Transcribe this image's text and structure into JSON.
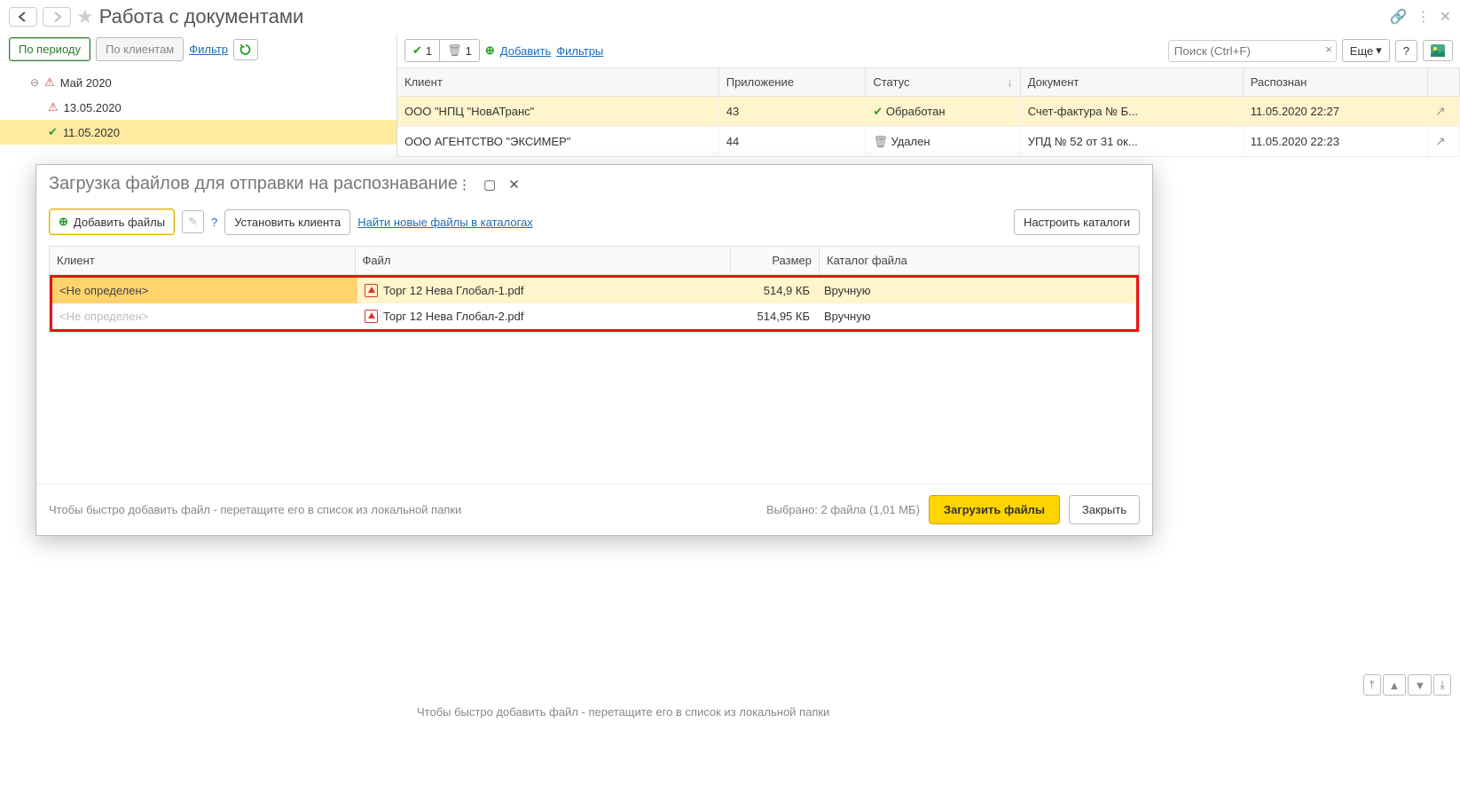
{
  "header": {
    "title": "Работа с документами"
  },
  "tabs": {
    "period": "По периоду",
    "clients": "По клиентам",
    "filter": "Фильтр"
  },
  "tree": {
    "month": "Май 2020",
    "date1": "13.05.2020",
    "date2": "11.05.2020"
  },
  "rtoolbar": {
    "ok_count": "1",
    "del_count": "1",
    "add": "Добавить",
    "filters": "Фильтры",
    "search_placeholder": "Поиск (Ctrl+F)",
    "more": "Еще",
    "help": "?"
  },
  "main_cols": {
    "client": "Клиент",
    "attach": "Приложение",
    "status": "Статус",
    "doc": "Документ",
    "recognized": "Распознан"
  },
  "main_rows": [
    {
      "client": "ООО \"НПЦ \"НовАТранс\"",
      "attach": "43",
      "status": "Обработан",
      "status_icon": "ok",
      "doc": "Счет-фактура № Б...",
      "rec": "11.05.2020 22:27"
    },
    {
      "client": "ООО АГЕНТСТВО \"ЭКСИМЕР\"",
      "attach": "44",
      "status": "Удален",
      "status_icon": "trash",
      "doc": "УПД № 52 от 31 ок...",
      "rec": "11.05.2020 22:23"
    }
  ],
  "modal": {
    "title": "Загрузка файлов для отправки на распознавание",
    "add_files": "Добавить файлы",
    "help": "?",
    "set_client": "Установить клиента",
    "find_new": "Найти новые файлы в каталогах",
    "setup_cat": "Настроить каталоги",
    "cols": {
      "client": "Клиент",
      "file": "Файл",
      "size": "Размер",
      "cat": "Каталог файла"
    },
    "rows": [
      {
        "client": "<Не определен>",
        "file": "Торг 12 Нева Глобал-1.pdf",
        "size": "514,9 КБ",
        "cat": "Вручную"
      },
      {
        "client": "<Не определен>",
        "file": "Торг 12 Нева Глобал-2.pdf",
        "size": "514,95 КБ",
        "cat": "Вручную"
      }
    ],
    "hint": "Чтобы быстро добавить файл - перетащите его в список из локальной папки",
    "selected": "Выбрано: 2 файла (1,01 МБ)",
    "upload": "Загрузить файлы",
    "close": "Закрыть"
  },
  "bottom_hint": "Чтобы быстро добавить файл - перетащите его в список из локальной папки"
}
